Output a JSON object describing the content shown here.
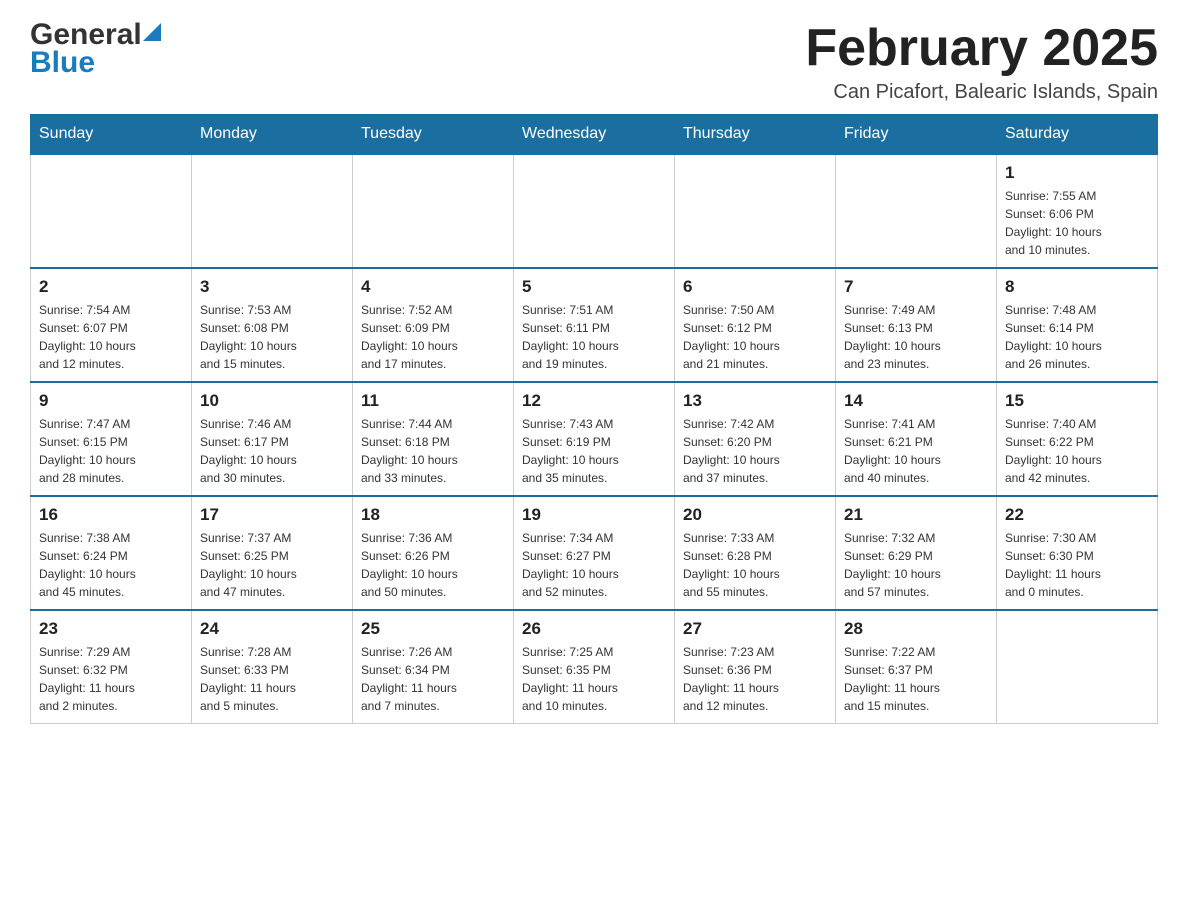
{
  "header": {
    "logo_general": "General",
    "logo_blue": "Blue",
    "title": "February 2025",
    "subtitle": "Can Picafort, Balearic Islands, Spain"
  },
  "calendar": {
    "days_of_week": [
      "Sunday",
      "Monday",
      "Tuesday",
      "Wednesday",
      "Thursday",
      "Friday",
      "Saturday"
    ],
    "weeks": [
      [
        {
          "day": "",
          "info": ""
        },
        {
          "day": "",
          "info": ""
        },
        {
          "day": "",
          "info": ""
        },
        {
          "day": "",
          "info": ""
        },
        {
          "day": "",
          "info": ""
        },
        {
          "day": "",
          "info": ""
        },
        {
          "day": "1",
          "info": "Sunrise: 7:55 AM\nSunset: 6:06 PM\nDaylight: 10 hours\nand 10 minutes."
        }
      ],
      [
        {
          "day": "2",
          "info": "Sunrise: 7:54 AM\nSunset: 6:07 PM\nDaylight: 10 hours\nand 12 minutes."
        },
        {
          "day": "3",
          "info": "Sunrise: 7:53 AM\nSunset: 6:08 PM\nDaylight: 10 hours\nand 15 minutes."
        },
        {
          "day": "4",
          "info": "Sunrise: 7:52 AM\nSunset: 6:09 PM\nDaylight: 10 hours\nand 17 minutes."
        },
        {
          "day": "5",
          "info": "Sunrise: 7:51 AM\nSunset: 6:11 PM\nDaylight: 10 hours\nand 19 minutes."
        },
        {
          "day": "6",
          "info": "Sunrise: 7:50 AM\nSunset: 6:12 PM\nDaylight: 10 hours\nand 21 minutes."
        },
        {
          "day": "7",
          "info": "Sunrise: 7:49 AM\nSunset: 6:13 PM\nDaylight: 10 hours\nand 23 minutes."
        },
        {
          "day": "8",
          "info": "Sunrise: 7:48 AM\nSunset: 6:14 PM\nDaylight: 10 hours\nand 26 minutes."
        }
      ],
      [
        {
          "day": "9",
          "info": "Sunrise: 7:47 AM\nSunset: 6:15 PM\nDaylight: 10 hours\nand 28 minutes."
        },
        {
          "day": "10",
          "info": "Sunrise: 7:46 AM\nSunset: 6:17 PM\nDaylight: 10 hours\nand 30 minutes."
        },
        {
          "day": "11",
          "info": "Sunrise: 7:44 AM\nSunset: 6:18 PM\nDaylight: 10 hours\nand 33 minutes."
        },
        {
          "day": "12",
          "info": "Sunrise: 7:43 AM\nSunset: 6:19 PM\nDaylight: 10 hours\nand 35 minutes."
        },
        {
          "day": "13",
          "info": "Sunrise: 7:42 AM\nSunset: 6:20 PM\nDaylight: 10 hours\nand 37 minutes."
        },
        {
          "day": "14",
          "info": "Sunrise: 7:41 AM\nSunset: 6:21 PM\nDaylight: 10 hours\nand 40 minutes."
        },
        {
          "day": "15",
          "info": "Sunrise: 7:40 AM\nSunset: 6:22 PM\nDaylight: 10 hours\nand 42 minutes."
        }
      ],
      [
        {
          "day": "16",
          "info": "Sunrise: 7:38 AM\nSunset: 6:24 PM\nDaylight: 10 hours\nand 45 minutes."
        },
        {
          "day": "17",
          "info": "Sunrise: 7:37 AM\nSunset: 6:25 PM\nDaylight: 10 hours\nand 47 minutes."
        },
        {
          "day": "18",
          "info": "Sunrise: 7:36 AM\nSunset: 6:26 PM\nDaylight: 10 hours\nand 50 minutes."
        },
        {
          "day": "19",
          "info": "Sunrise: 7:34 AM\nSunset: 6:27 PM\nDaylight: 10 hours\nand 52 minutes."
        },
        {
          "day": "20",
          "info": "Sunrise: 7:33 AM\nSunset: 6:28 PM\nDaylight: 10 hours\nand 55 minutes."
        },
        {
          "day": "21",
          "info": "Sunrise: 7:32 AM\nSunset: 6:29 PM\nDaylight: 10 hours\nand 57 minutes."
        },
        {
          "day": "22",
          "info": "Sunrise: 7:30 AM\nSunset: 6:30 PM\nDaylight: 11 hours\nand 0 minutes."
        }
      ],
      [
        {
          "day": "23",
          "info": "Sunrise: 7:29 AM\nSunset: 6:32 PM\nDaylight: 11 hours\nand 2 minutes."
        },
        {
          "day": "24",
          "info": "Sunrise: 7:28 AM\nSunset: 6:33 PM\nDaylight: 11 hours\nand 5 minutes."
        },
        {
          "day": "25",
          "info": "Sunrise: 7:26 AM\nSunset: 6:34 PM\nDaylight: 11 hours\nand 7 minutes."
        },
        {
          "day": "26",
          "info": "Sunrise: 7:25 AM\nSunset: 6:35 PM\nDaylight: 11 hours\nand 10 minutes."
        },
        {
          "day": "27",
          "info": "Sunrise: 7:23 AM\nSunset: 6:36 PM\nDaylight: 11 hours\nand 12 minutes."
        },
        {
          "day": "28",
          "info": "Sunrise: 7:22 AM\nSunset: 6:37 PM\nDaylight: 11 hours\nand 15 minutes."
        },
        {
          "day": "",
          "info": ""
        }
      ]
    ]
  }
}
